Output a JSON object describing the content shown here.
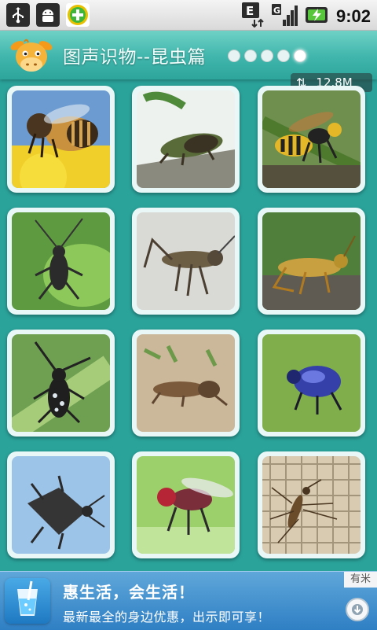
{
  "status_bar": {
    "time": "9:02",
    "left_icons": [
      "usb-icon",
      "android-debug-icon",
      "add-app-icon"
    ],
    "right_icons": [
      "edge-data-icon",
      "signal-icon",
      "battery-charging-icon"
    ]
  },
  "header": {
    "title": "图声识物--昆虫篇",
    "page_dots": {
      "count": 5,
      "active_index": 4
    }
  },
  "net_badge": {
    "speed": "12.8M",
    "icon": "up-down-arrows-icon"
  },
  "grid": {
    "columns": 3,
    "rows": 4,
    "items": [
      {
        "name": "bee"
      },
      {
        "name": "cicada"
      },
      {
        "name": "wasp"
      },
      {
        "name": "cricket"
      },
      {
        "name": "katydid"
      },
      {
        "name": "grasshopper"
      },
      {
        "name": "longhorn-beetle"
      },
      {
        "name": "mole-cricket"
      },
      {
        "name": "scarab-beetle"
      },
      {
        "name": "stink-bug"
      },
      {
        "name": "fly"
      },
      {
        "name": "mosquito"
      }
    ]
  },
  "ad": {
    "title": "惠生活，会生活！",
    "subtitle": "最新最全的身边优惠，出示即可享！",
    "tag": "有米",
    "icon": "drink-cup-icon",
    "download_icon": "download-icon"
  }
}
